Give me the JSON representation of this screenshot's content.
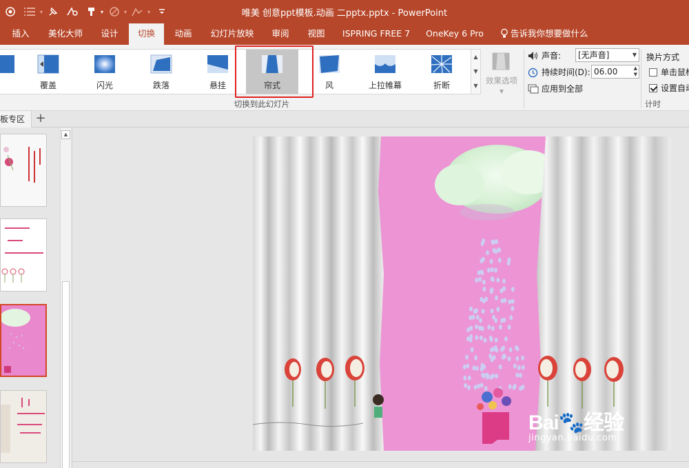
{
  "window": {
    "title": "唯美 创意ppt模板.动画 二pptx.pptx  -  PowerPoint"
  },
  "tabs": [
    {
      "label": "插入"
    },
    {
      "label": "美化大师"
    },
    {
      "label": "设计"
    },
    {
      "label": "切换",
      "active": true
    },
    {
      "label": "动画"
    },
    {
      "label": "幻灯片放映"
    },
    {
      "label": "审阅"
    },
    {
      "label": "视图"
    },
    {
      "label": "ISPRING FREE 7"
    },
    {
      "label": "OneKey 6 Pro"
    }
  ],
  "tell_me": "告诉我你想要做什么",
  "transitions": [
    {
      "label": "覆盖",
      "icon": "cover-icon"
    },
    {
      "label": "闪光",
      "icon": "flash-icon"
    },
    {
      "label": "跌落",
      "icon": "fall-over-icon"
    },
    {
      "label": "悬挂",
      "icon": "drape-icon"
    },
    {
      "label": "帘式",
      "icon": "curtains-icon",
      "selected": true
    },
    {
      "label": "风",
      "icon": "wind-icon"
    },
    {
      "label": "上拉帷幕",
      "icon": "prestige-icon"
    },
    {
      "label": "折断",
      "icon": "fracture-icon"
    }
  ],
  "effect_options": "效果选项",
  "group_transition_label": "切换到此幻灯片",
  "timing": {
    "sound_label": "声音:",
    "sound_value": "[无声音]",
    "duration_label": "持续时间(D):",
    "duration_value": "06.00",
    "apply_all": "应用到全部",
    "advance_header": "换片方式",
    "on_click": "单击鼠标",
    "on_click_checked": false,
    "after_auto": "设置自动",
    "after_auto_checked": true,
    "group_label": "计时"
  },
  "panel": {
    "tab_label": "板专区",
    "add": "+"
  },
  "watermark": {
    "brand": "Bai",
    "brand_suffix": "经验",
    "url": "jingyan.baidu.com"
  },
  "colors": {
    "accent": "#b7472a",
    "selected_highlight": "#e02020"
  }
}
